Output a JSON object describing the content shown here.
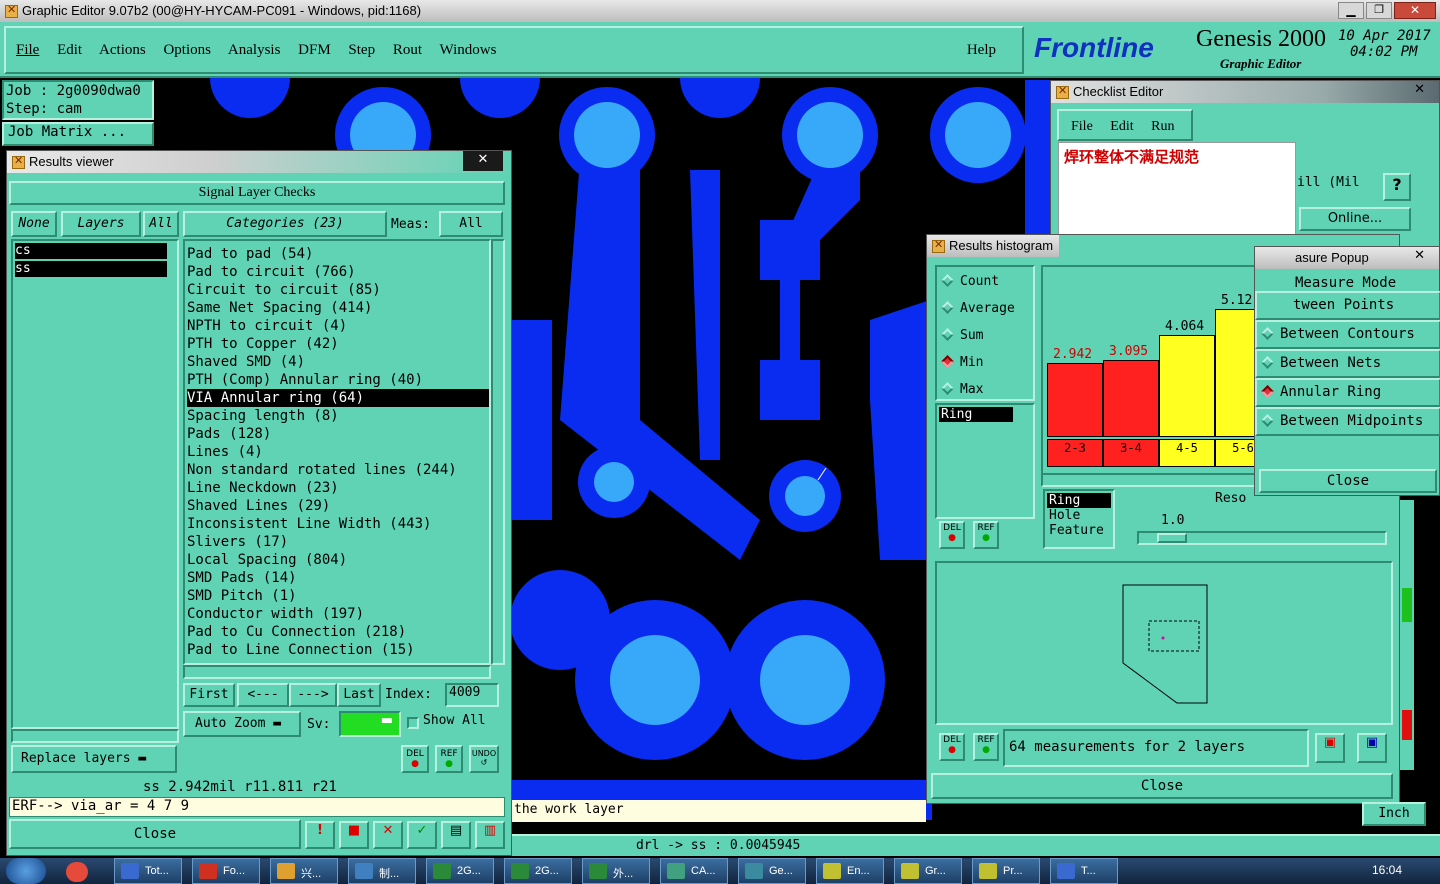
{
  "window": {
    "title": "Graphic Editor 9.07b2 (00@HY-HYCAM-PC091 - Windows, pid:1168)"
  },
  "menubar": {
    "items": [
      "File",
      "Edit",
      "Actions",
      "Options",
      "Analysis",
      "DFM",
      "Step",
      "Rout",
      "Windows"
    ],
    "help": "Help"
  },
  "brand": {
    "logo": "Frontline",
    "product": "Genesis 2000",
    "sub": "Graphic Editor",
    "date": "10 Apr 2017",
    "time": "04:02 PM"
  },
  "job": {
    "job": "Job  : 2g0090dwa0",
    "step": "Step: cam",
    "matrix": "Job Matrix ..."
  },
  "results_viewer": {
    "title": "Results viewer",
    "header": "Signal Layer Checks",
    "btn_none": "None",
    "btn_layers": "Layers",
    "btn_all": "All",
    "layers": [
      "cs",
      "ss"
    ],
    "categories_label": "Categories (23)",
    "meas_label": "Meas:",
    "meas_value": "All",
    "categories": [
      "Pad to pad (54)",
      "Pad to circuit (766)",
      "Circuit to circuit (85)",
      "Same Net Spacing (414)",
      "NPTH to circuit (4)",
      "PTH to Copper (42)",
      "Shaved SMD (4)",
      "PTH (Comp) Annular ring (40)",
      "VIA Annular ring (64)",
      "Spacing length (8)",
      "Pads (128)",
      "Lines (4)",
      "Non standard rotated lines (244)",
      "Line Neckdown (23)",
      "Shaved Lines (29)",
      "Inconsistent Line Width (443)",
      "Slivers (17)",
      "Local Spacing (804)",
      "SMD Pads (14)",
      "SMD Pitch (1)",
      "Conductor width (197)",
      "Pad to Cu Connection (218)",
      "Pad to Line Connection (15)"
    ],
    "selected_index": 8,
    "nav": {
      "first": "First",
      "prev": "<---",
      "next": "--->",
      "last": "Last",
      "index_label": "Index:",
      "index_value": "4009"
    },
    "auto_zoom": "Auto Zoom",
    "sv_label": "Sv:",
    "show_all": "Show All",
    "replace_layers": "Replace layers",
    "status": "ss 2.942mil  r11.811  r21",
    "erf": "ERF--> via_ar = 4 7 9",
    "close": "Close",
    "icon_del": "DEL",
    "icon_ref": "REF",
    "icon_undo": "UNDO"
  },
  "checklist_editor": {
    "title": "Checklist Editor",
    "menu": [
      "File",
      "Edit",
      "Run"
    ],
    "text": "焊环整体不满足规范",
    "mil": "ill (Mil",
    "online": "Online..."
  },
  "histogram": {
    "title": "Results histogram",
    "modes": [
      "Count",
      "Average",
      "Sum",
      "Min",
      "Max"
    ],
    "selected_mode": "Min",
    "list1": [
      "Ring"
    ],
    "list2": [
      "Ring",
      "Hole",
      "Feature"
    ],
    "reso_label": "Reso",
    "reso_value": "1.0",
    "bars": [
      {
        "label": "2.942",
        "range": "2-3",
        "color": "#ff2020",
        "value": 2.942
      },
      {
        "label": "3.095",
        "range": "3-4",
        "color": "#ff2020",
        "value": 3.095
      },
      {
        "label": "4.064",
        "range": "4-5",
        "color": "#ffff20",
        "value": 4.064
      },
      {
        "label": "5.12",
        "range": "5-6",
        "color": "#ffff20",
        "value": 5.12
      }
    ],
    "measurements": "64 measurements for 2 layers",
    "close": "Close",
    "icon_del": "DEL",
    "icon_ref": "REF"
  },
  "measure_popup": {
    "title": "asure Popup",
    "header": "Measure Mode",
    "items": [
      "tween Points",
      "Between Contours",
      "Between Nets",
      "Annular Ring",
      "Between Midpoints"
    ],
    "selected": "Annular Ring",
    "close": "Close"
  },
  "footer": {
    "hint": "the work layer",
    "drl": "drl -> ss : 0.0045945",
    "inch": "Inch"
  },
  "taskbar": {
    "items": [
      "Tot...",
      "Fo...",
      "兴...",
      "制...",
      "2G...",
      "2G...",
      "外...",
      "CA...",
      "Ge...",
      "En...",
      "Gr...",
      "Pr...",
      "T..."
    ],
    "clock": "16:04"
  },
  "colors": {
    "board": "#0a2cf0",
    "pad": "#38a8f8",
    "panel": "#5fd3b3"
  }
}
